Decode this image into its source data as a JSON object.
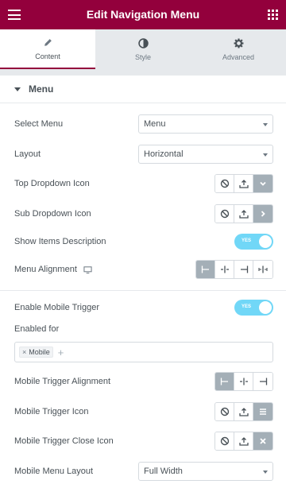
{
  "header": {
    "title": "Edit Navigation Menu",
    "menu_icon": "hamburger-icon",
    "apps_icon": "grid-icon"
  },
  "tabs": [
    {
      "label": "Content",
      "icon": "pencil-icon",
      "active": true
    },
    {
      "label": "Style",
      "icon": "contrast-icon",
      "active": false
    },
    {
      "label": "Advanced",
      "icon": "gear-icon",
      "active": false
    }
  ],
  "section": {
    "title": "Menu"
  },
  "fields": {
    "select_menu": {
      "label": "Select Menu",
      "value": "Menu"
    },
    "layout": {
      "label": "Layout",
      "value": "Horizontal"
    },
    "top_dropdown_icon": {
      "label": "Top Dropdown Icon"
    },
    "sub_dropdown_icon": {
      "label": "Sub Dropdown Icon"
    },
    "show_items_description": {
      "label": "Show Items Description",
      "toggle_text": "YES",
      "on": true
    },
    "menu_alignment": {
      "label": "Menu Alignment"
    },
    "enable_mobile_trigger": {
      "label": "Enable Mobile Trigger",
      "toggle_text": "YES",
      "on": true
    },
    "enabled_for": {
      "label": "Enabled for",
      "tags": [
        "Mobile"
      ],
      "tag_remove": "×",
      "add_symbol": "+"
    },
    "mobile_trigger_alignment": {
      "label": "Mobile Trigger Alignment"
    },
    "mobile_trigger_icon": {
      "label": "Mobile Trigger Icon"
    },
    "mobile_trigger_close_icon": {
      "label": "Mobile Trigger Close Icon"
    },
    "mobile_menu_layout": {
      "label": "Mobile Menu Layout",
      "value": "Full Width"
    }
  },
  "colors": {
    "brand": "#93003c",
    "toggle_on": "#71d7f7",
    "selected_option": "#a4afb7",
    "text": "#495157"
  }
}
